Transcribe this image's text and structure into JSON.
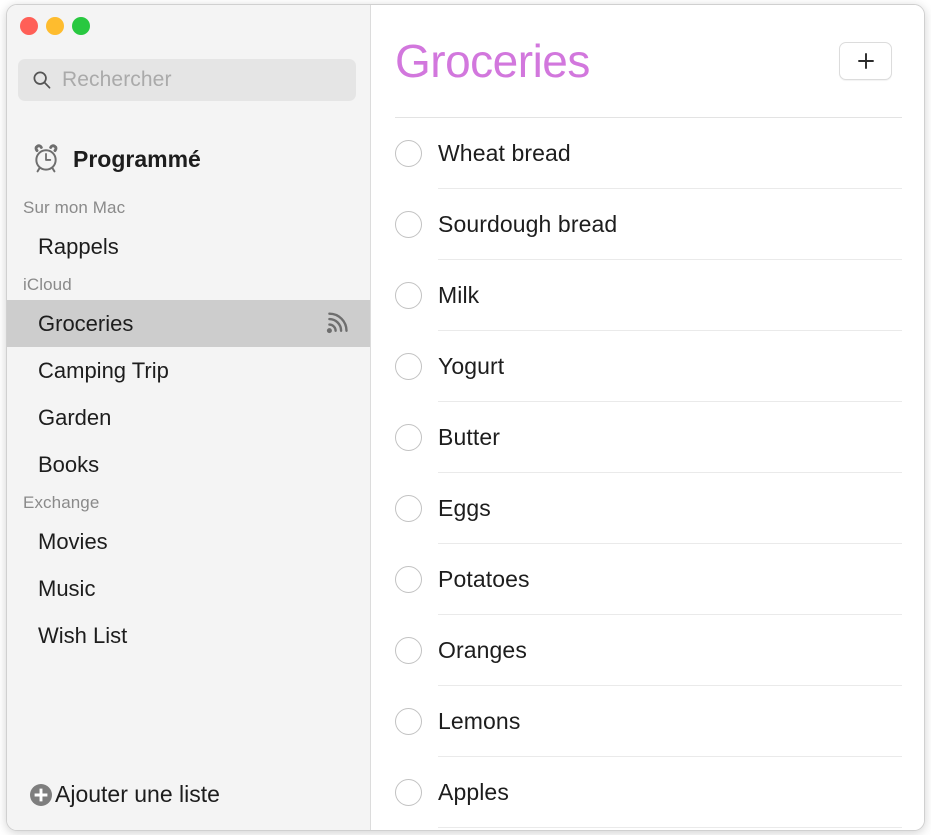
{
  "window": {
    "traffic_lights": [
      {
        "name": "close",
        "color": "#ff5f57"
      },
      {
        "name": "minimize",
        "color": "#febc2e"
      },
      {
        "name": "zoom",
        "color": "#28c840"
      }
    ]
  },
  "sidebar": {
    "search": {
      "placeholder": "Rechercher",
      "value": "",
      "icon": "search-icon"
    },
    "smart_list": {
      "label": "Programmé",
      "icon": "alarm-clock-icon"
    },
    "sections": [
      {
        "header": "Sur mon Mac",
        "items": [
          {
            "label": "Rappels",
            "selected": false,
            "shared": false
          }
        ]
      },
      {
        "header": "iCloud",
        "items": [
          {
            "label": "Groceries",
            "selected": true,
            "shared": true,
            "share_icon": "shared-list-icon"
          },
          {
            "label": "Camping Trip",
            "selected": false,
            "shared": false
          },
          {
            "label": "Garden",
            "selected": false,
            "shared": false
          },
          {
            "label": "Books",
            "selected": false,
            "shared": false
          }
        ]
      },
      {
        "header": "Exchange",
        "items": [
          {
            "label": "Movies",
            "selected": false,
            "shared": false
          },
          {
            "label": "Music",
            "selected": false,
            "shared": false
          },
          {
            "label": "Wish List",
            "selected": false,
            "shared": false
          }
        ]
      }
    ],
    "add_list": {
      "label": "Ajouter une liste",
      "icon": "plus-circle-icon"
    }
  },
  "content": {
    "title": "Groceries",
    "title_color": "#d277dd",
    "add_button": {
      "label": "+",
      "icon": "plus-icon"
    },
    "reminders": [
      {
        "title": "Wheat bread",
        "completed": false
      },
      {
        "title": "Sourdough bread",
        "completed": false
      },
      {
        "title": "Milk",
        "completed": false
      },
      {
        "title": "Yogurt",
        "completed": false
      },
      {
        "title": "Butter",
        "completed": false
      },
      {
        "title": "Eggs",
        "completed": false
      },
      {
        "title": "Potatoes",
        "completed": false
      },
      {
        "title": "Oranges",
        "completed": false
      },
      {
        "title": "Lemons",
        "completed": false
      },
      {
        "title": "Apples",
        "completed": false
      }
    ]
  }
}
